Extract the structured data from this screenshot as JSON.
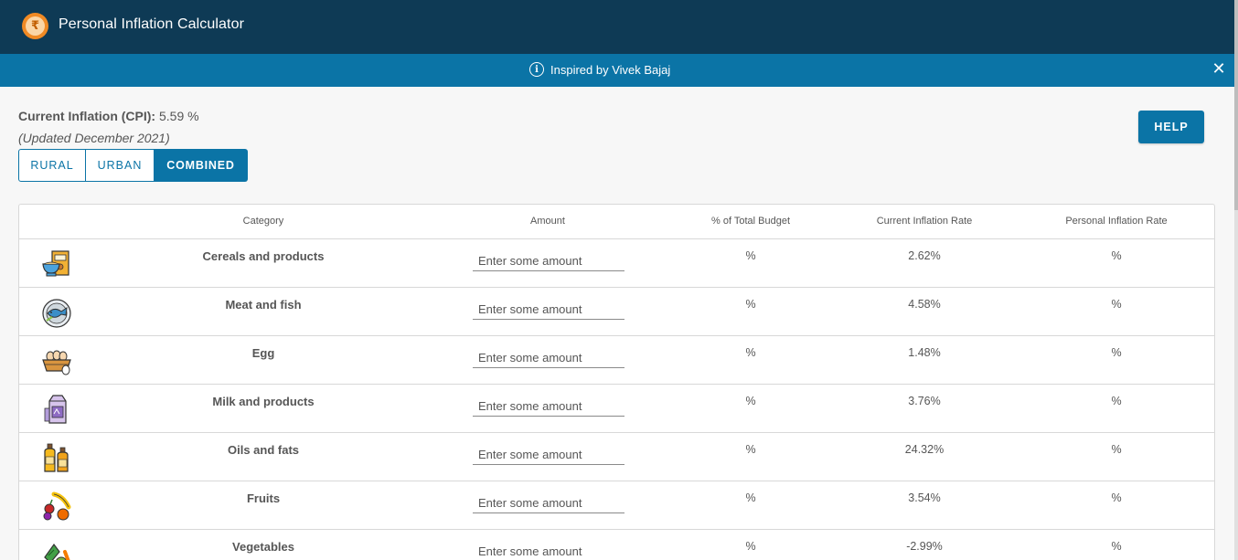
{
  "app": {
    "title": "Personal Inflation Calculator",
    "logo_symbol": "₹",
    "logo_icon": "rupee-coin-icon"
  },
  "banner": {
    "text": "Inspired by Vivek Bajaj",
    "icon": "info-icon",
    "close_symbol": "✕"
  },
  "cpi": {
    "label": "Current Inflation (CPI):",
    "value": "5.59 %",
    "updated": "(Updated December 2021)"
  },
  "area_selector": {
    "options": [
      "RURAL",
      "URBAN",
      "COMBINED"
    ],
    "selected": "COMBINED"
  },
  "help_button": "HELP",
  "table": {
    "headers": {
      "category": "Category",
      "amount": "Amount",
      "pct_budget": "% of Total Budget",
      "current_rate": "Current Inflation Rate",
      "personal_rate": "Personal Inflation Rate"
    },
    "rows": [
      {
        "category": "Cereals and products",
        "icon": "cereal-bowl-icon",
        "amount_placeholder": "Enter some amount",
        "pct_budget": "%",
        "current_rate": "2.62%",
        "personal_rate": "%"
      },
      {
        "category": "Meat and fish",
        "icon": "fish-plate-icon",
        "amount_placeholder": "Enter some amount",
        "pct_budget": "%",
        "current_rate": "4.58%",
        "personal_rate": "%"
      },
      {
        "category": "Egg",
        "icon": "egg-basket-icon",
        "amount_placeholder": "Enter some amount",
        "pct_budget": "%",
        "current_rate": "1.48%",
        "personal_rate": "%"
      },
      {
        "category": "Milk and products",
        "icon": "milk-carton-icon",
        "amount_placeholder": "Enter some amount",
        "pct_budget": "%",
        "current_rate": "3.76%",
        "personal_rate": "%"
      },
      {
        "category": "Oils and fats",
        "icon": "oil-bottles-icon",
        "amount_placeholder": "Enter some amount",
        "pct_budget": "%",
        "current_rate": "24.32%",
        "personal_rate": "%"
      },
      {
        "category": "Fruits",
        "icon": "fruits-icon",
        "amount_placeholder": "Enter some amount",
        "pct_budget": "%",
        "current_rate": "3.54%",
        "personal_rate": "%"
      },
      {
        "category": "Vegetables",
        "icon": "vegetables-icon",
        "amount_placeholder": "Enter some amount",
        "pct_budget": "%",
        "current_rate": "-2.99%",
        "personal_rate": "%"
      }
    ]
  },
  "colors": {
    "header_bg": "#0e3a55",
    "banner_bg": "#0b74a6",
    "accent": "#0b74a6",
    "page_bg": "#f7f7f7",
    "text": "#565656"
  }
}
